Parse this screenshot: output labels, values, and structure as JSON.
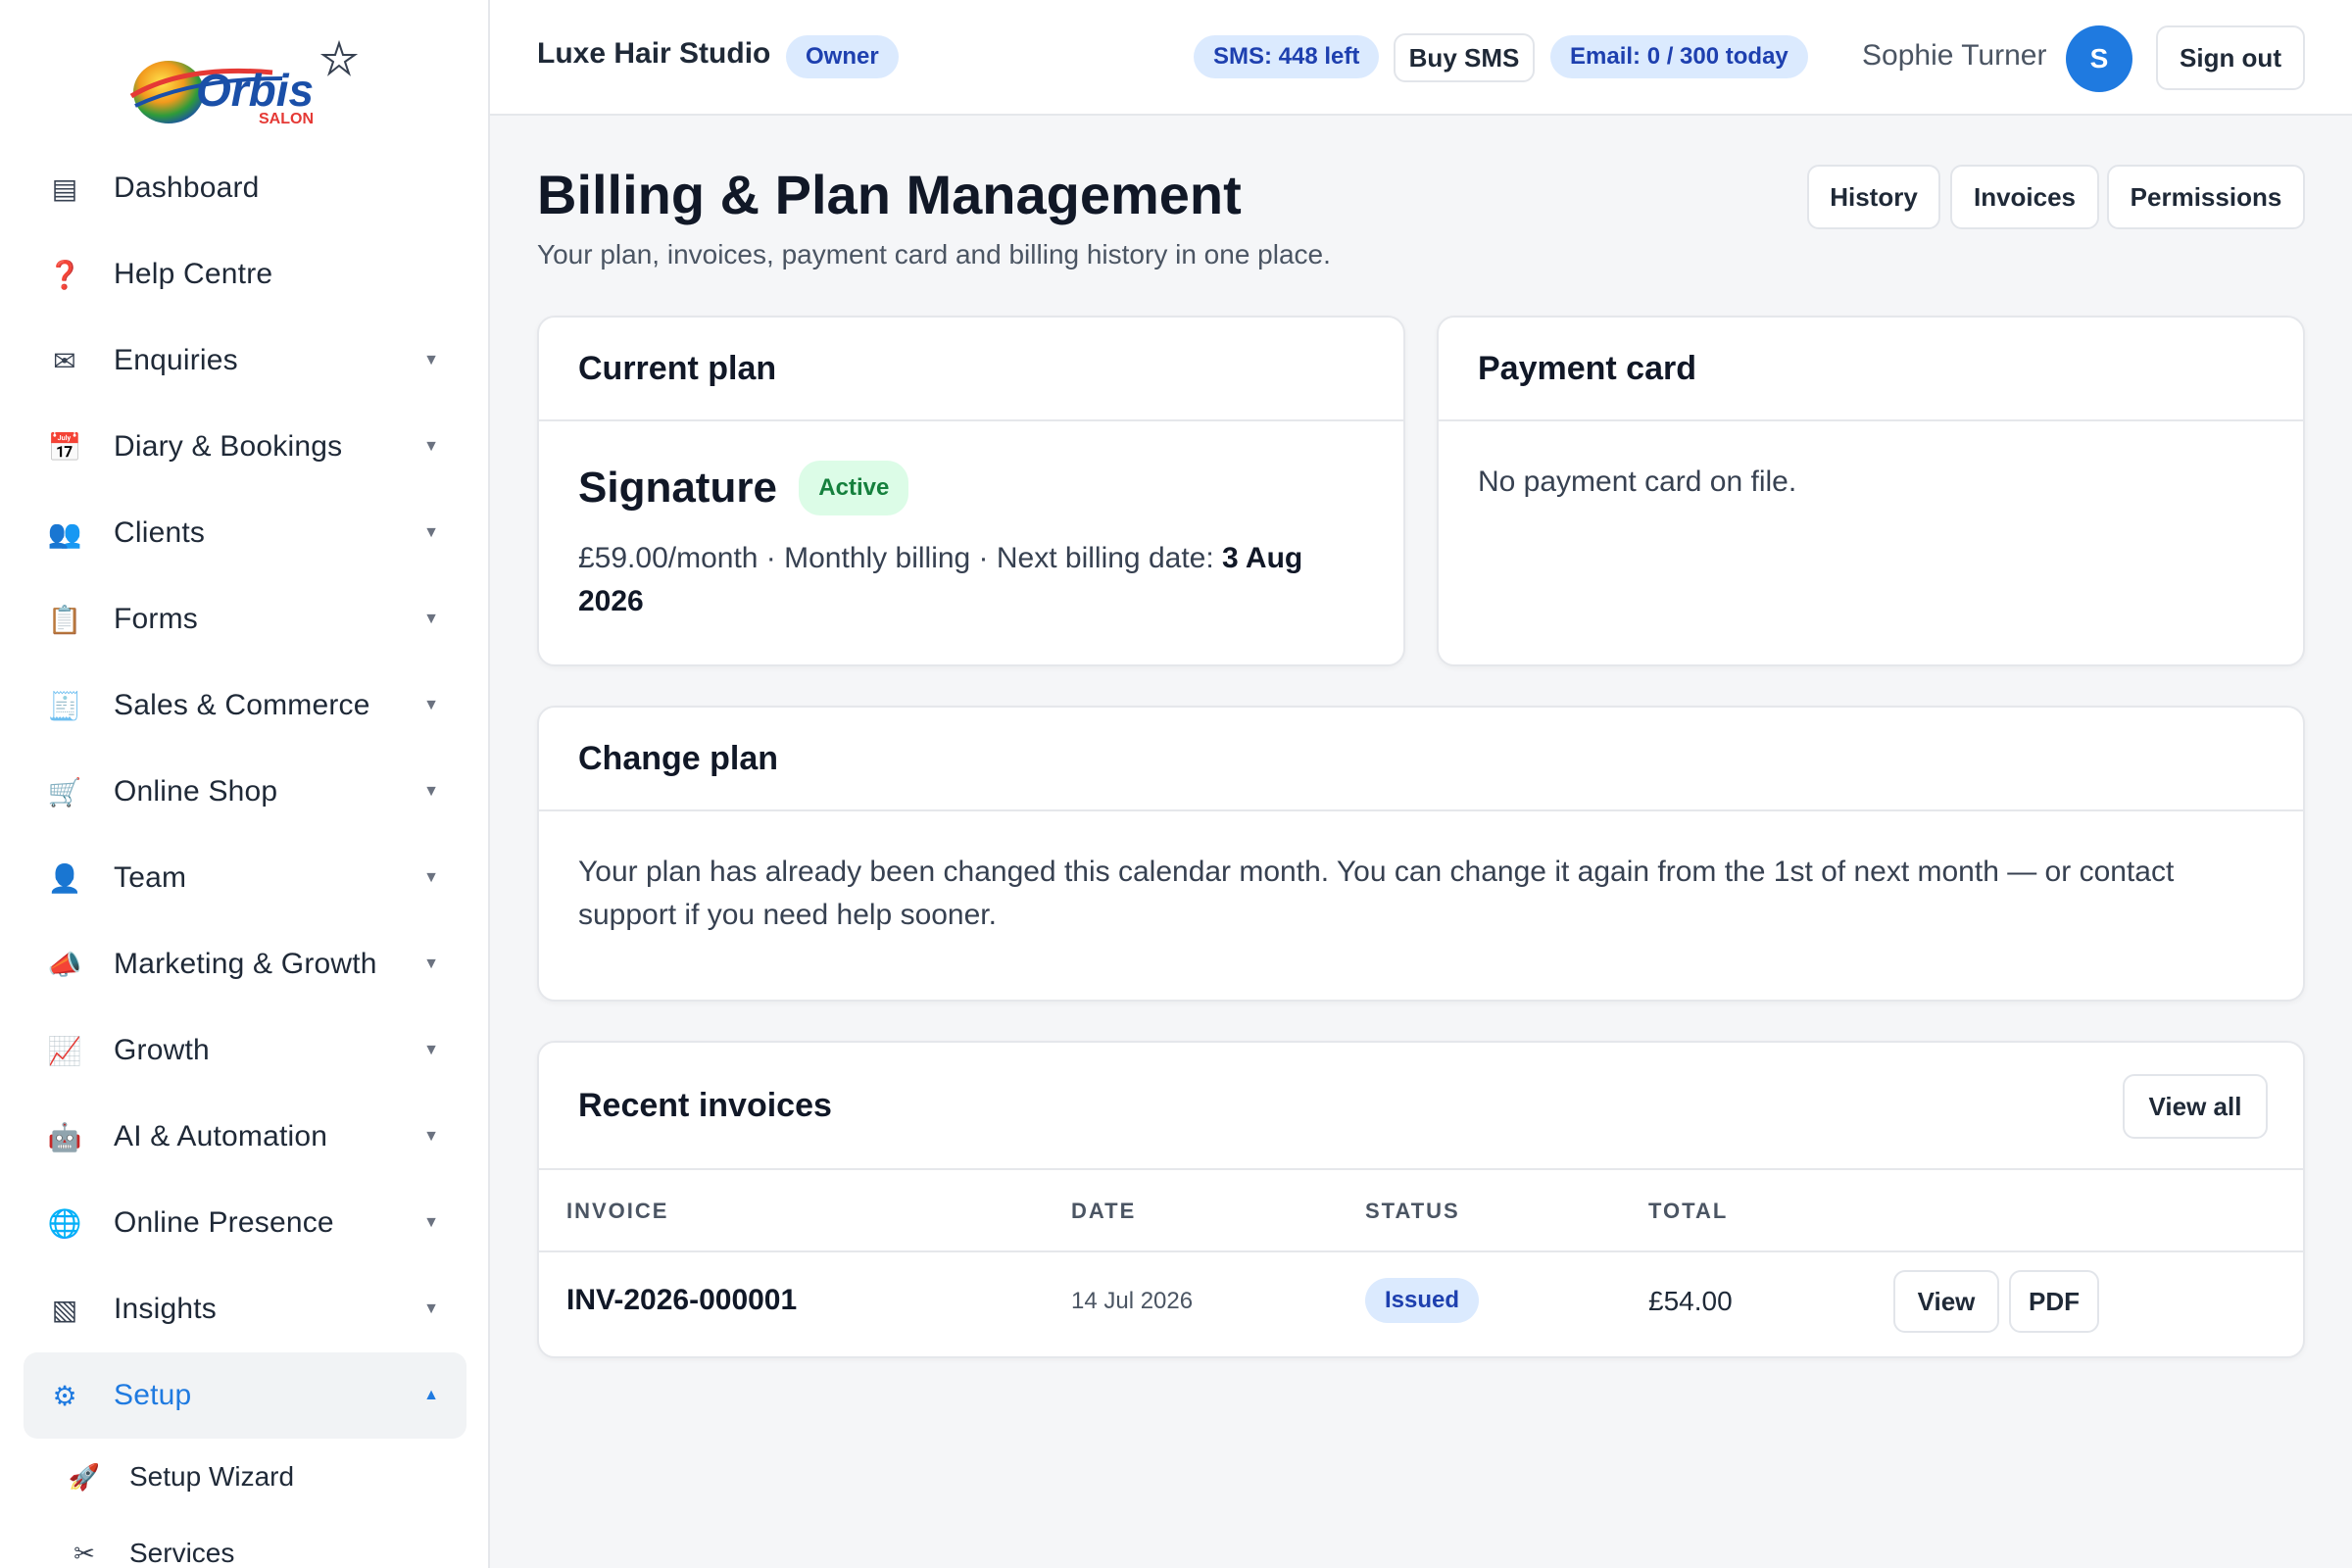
{
  "brand": {
    "logo_text": "Orbis",
    "logo_sub": "SALON"
  },
  "sidebar": {
    "items": [
      {
        "icon": "dashboard-icon",
        "glyph": "▤",
        "label": "Dashboard",
        "caret": ""
      },
      {
        "icon": "help-icon",
        "glyph": "❓",
        "label": "Help Centre",
        "caret": ""
      },
      {
        "icon": "envelope-icon",
        "glyph": "✉",
        "label": "Enquiries",
        "caret": "▼"
      },
      {
        "icon": "calendar-icon",
        "glyph": "📅",
        "label": "Diary & Bookings",
        "caret": "▼"
      },
      {
        "icon": "clients-icon",
        "glyph": "👥",
        "label": "Clients",
        "caret": "▼"
      },
      {
        "icon": "clipboard-icon",
        "glyph": "📋",
        "label": "Forms",
        "caret": "▼"
      },
      {
        "icon": "receipt-icon",
        "glyph": "🧾",
        "label": "Sales & Commerce",
        "caret": "▼"
      },
      {
        "icon": "cart-icon",
        "glyph": "🛒",
        "label": "Online Shop",
        "caret": "▼"
      },
      {
        "icon": "user-icon",
        "glyph": "👤",
        "label": "Team",
        "caret": "▼"
      },
      {
        "icon": "megaphone-icon",
        "glyph": "📣",
        "label": "Marketing & Growth",
        "caret": "▼"
      },
      {
        "icon": "chart-up-icon",
        "glyph": "📈",
        "label": "Growth",
        "caret": "▼"
      },
      {
        "icon": "robot-icon",
        "glyph": "🤖",
        "label": "AI & Automation",
        "caret": "▼"
      },
      {
        "icon": "globe-icon",
        "glyph": "🌐",
        "label": "Online Presence",
        "caret": "▼"
      },
      {
        "icon": "insights-icon",
        "glyph": "▧",
        "label": "Insights",
        "caret": "▼"
      },
      {
        "icon": "gear-icon",
        "glyph": "⚙",
        "label": "Setup",
        "caret": "▲"
      }
    ],
    "sub_items": [
      {
        "icon": "rocket-icon",
        "glyph": "🚀",
        "label": "Setup Wizard"
      },
      {
        "icon": "scissors-icon",
        "glyph": "✂",
        "label": "Services"
      }
    ]
  },
  "header": {
    "studio_name": "Luxe Hair Studio",
    "role_badge": "Owner",
    "sms_badge": "SMS: 448 left",
    "buy_sms": "Buy SMS",
    "email_badge": "Email: 0 / 300 today",
    "user_name": "Sophie Turner",
    "avatar_initial": "S",
    "sign_out": "Sign out"
  },
  "page": {
    "title": "Billing & Plan Management",
    "subtitle": "Your plan, invoices, payment card and billing history in one place.",
    "actions": {
      "history": "History",
      "invoices": "Invoices",
      "permissions": "Permissions"
    }
  },
  "current_plan": {
    "heading": "Current plan",
    "name": "Signature",
    "status": "Active",
    "details": "£59.00/month · Monthly billing · Next billing date: ",
    "next_date": "3 Aug 2026"
  },
  "payment_card": {
    "heading": "Payment card",
    "message": "No payment card on file."
  },
  "change_plan": {
    "heading": "Change plan",
    "message": "Your plan has already been changed this calendar month. You can change it again from the 1st of next month — or contact support if you need help sooner."
  },
  "invoices": {
    "heading": "Recent invoices",
    "view_all": "View all",
    "columns": {
      "invoice": "INVOICE",
      "date": "DATE",
      "status": "STATUS",
      "total": "TOTAL"
    },
    "rows": [
      {
        "number": "INV-2026-000001",
        "date": "14 Jul 2026",
        "status": "Issued",
        "total": "£54.00",
        "view": "View",
        "pdf": "PDF"
      }
    ]
  },
  "colors": {
    "accent": "#1f7ae0",
    "active_green": "#15803d",
    "badge_blue": "#1e40af"
  }
}
